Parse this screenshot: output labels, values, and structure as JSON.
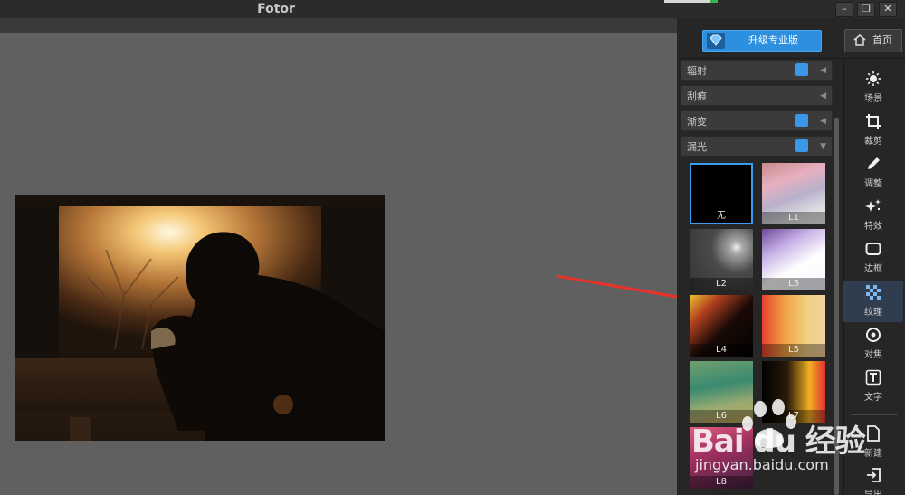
{
  "window": {
    "title": "Fotor",
    "controls": [
      "–",
      "❐",
      "✕"
    ]
  },
  "header": {
    "upgrade_label": "升级专业版",
    "home_label": "首页"
  },
  "categories": [
    {
      "label": "辐射",
      "pro": true
    },
    {
      "label": "刮痕",
      "pro": false
    },
    {
      "label": "渐变",
      "pro": true
    },
    {
      "label": "漏光",
      "pro": true
    }
  ],
  "textures": [
    {
      "label": "无",
      "selected": true
    },
    {
      "label": "L1"
    },
    {
      "label": "L2"
    },
    {
      "label": "L3"
    },
    {
      "label": "L4"
    },
    {
      "label": "L5"
    },
    {
      "label": "L6"
    },
    {
      "label": "L7"
    },
    {
      "label": "L8"
    }
  ],
  "tools": [
    {
      "label": "场景",
      "icon": "sun-icon"
    },
    {
      "label": "裁剪",
      "icon": "crop-icon"
    },
    {
      "label": "调整",
      "icon": "pencil-icon"
    },
    {
      "label": "特效",
      "icon": "sparkle-icon"
    },
    {
      "label": "边框",
      "icon": "frame-icon"
    },
    {
      "label": "纹理",
      "icon": "texture-icon",
      "active": true
    },
    {
      "label": "对焦",
      "icon": "focus-icon"
    },
    {
      "label": "文字",
      "icon": "text-icon"
    },
    {
      "label": "新建",
      "icon": "new-file-icon"
    },
    {
      "label": "导出",
      "icon": "export-icon"
    }
  ],
  "watermark": {
    "brand": "Bai du 经验",
    "url": "jingyan.baidu.com"
  },
  "colors": {
    "accent": "#2d8fe0",
    "panel": "#262626",
    "canvas": "#606060",
    "arrow": "#e8322b"
  }
}
